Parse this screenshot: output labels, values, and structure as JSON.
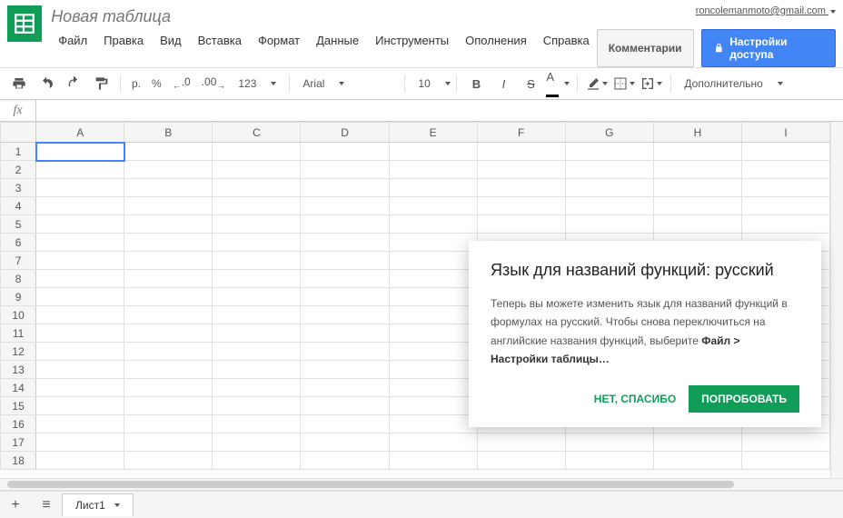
{
  "header": {
    "doc_title": "Новая таблица",
    "user_email": "roncolemanmoto@gmail.com",
    "comments_btn": "Комментарии",
    "share_btn": "Настройки доступа"
  },
  "menus": [
    "Файл",
    "Правка",
    "Вид",
    "Вставка",
    "Формат",
    "Данные",
    "Инструменты",
    "Ополнения",
    "Справка"
  ],
  "toolbar": {
    "currency": "р.",
    "percent": "%",
    "dec_dec": ".0",
    "inc_dec": ".00",
    "num_fmt": "123",
    "font": "Arial",
    "size": "10",
    "more": "Дополнительно"
  },
  "formula_bar": {
    "label": "fx",
    "value": ""
  },
  "columns": [
    "A",
    "B",
    "C",
    "D",
    "E",
    "F",
    "G",
    "H",
    "I"
  ],
  "rows": [
    1,
    2,
    3,
    4,
    5,
    6,
    7,
    8,
    9,
    10,
    11,
    12,
    13,
    14,
    15,
    16,
    17,
    18
  ],
  "selected_cell": "A1",
  "sheet_tabs": {
    "add": "+",
    "sheet1": "Лист1"
  },
  "popup": {
    "title": "Язык для названий функций: русский",
    "body_pre": "Теперь вы можете изменить язык для названий функций в формулах на русский. Чтобы снова переключиться на английские названия функций, выберите ",
    "body_bold": "Файл > Настройки таблицы…",
    "dismiss": "НЕТ, СПАСИБО",
    "try": "ПОПРОБОВАТЬ"
  }
}
